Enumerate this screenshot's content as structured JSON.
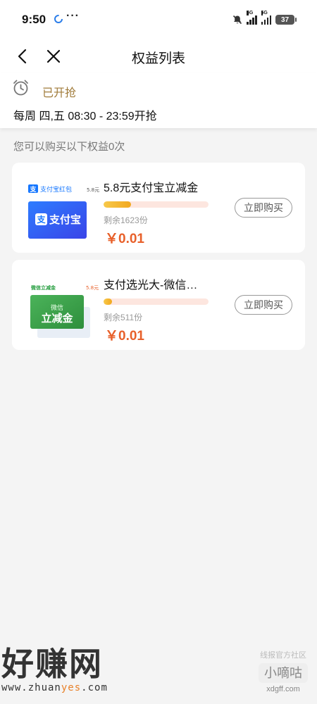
{
  "status_bar": {
    "time": "9:50",
    "dots": "···",
    "network_1": "5G",
    "network_2": "5G",
    "battery": "37"
  },
  "nav": {
    "title": "权益列表",
    "back_icon": "back-arrow-icon",
    "close_icon": "close-icon"
  },
  "info": {
    "status": "已开抢",
    "time_window": "每周 四,五 08:30 - 23:59开抢"
  },
  "summary": "您可以购买以下权益0次",
  "items": [
    {
      "title": "5.8元支付宝立减金",
      "remaining": "剩余1623份",
      "price": "￥0.01",
      "progress": 0.26,
      "button": "立即购买",
      "image": {
        "brand_label": "支付宝红包",
        "amount": "5.8元",
        "center_text": "支付宝"
      }
    },
    {
      "title": "支付选光大-微信…",
      "remaining": "剩余511份",
      "price": "￥0.01",
      "progress": 0.08,
      "button": "立即购买",
      "image": {
        "brand_label": "微信立减金",
        "amount": "5.8元",
        "line1": "微信",
        "line2": "立减金"
      }
    }
  ],
  "watermarks": {
    "left_big": "好赚网",
    "left_url_a": "www.zhuan",
    "left_url_b": "yes",
    "left_url_c": ".com",
    "right_top": "线报官方社区",
    "right_box": "小嘀咕",
    "right_url": "xdgff.com"
  },
  "colors": {
    "accent_price": "#e8602a",
    "status_gold": "#a07b3a",
    "progress_track": "#fde6df",
    "alipay_blue": "#1677ff",
    "wechat_green": "#2aa043"
  }
}
